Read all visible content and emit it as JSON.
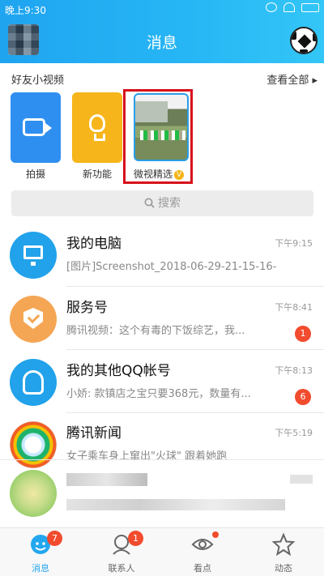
{
  "status": {
    "time": "晚上9:30"
  },
  "header": {
    "title": "消息"
  },
  "videos": {
    "section_title": "好友小视频",
    "see_all": "查看全部 ▸",
    "cards": [
      {
        "label": "拍摄"
      },
      {
        "label": "新功能"
      },
      {
        "label": "微视精选",
        "badge": "V"
      }
    ]
  },
  "search": {
    "placeholder": "搜索"
  },
  "conversations": [
    {
      "name": "我的电脑",
      "message": "[图片]Screenshot_2018-06-29-21-15-16-...",
      "time": "下午9:15",
      "unread": ""
    },
    {
      "name": "服务号",
      "message": "腾讯视频：这个有毒的下饭综艺，我...",
      "time": "下午8:41",
      "unread": "1"
    },
    {
      "name": "我的其他QQ帐号",
      "message": "小娇: 款镇店之宝只要368元，数量有...",
      "time": "下午8:13",
      "unread": "6"
    },
    {
      "name": "腾讯新闻",
      "message": "女子乘车身上窜出\"火球\" 跟着她跑",
      "time": "下午5:19",
      "unread": ""
    }
  ],
  "nav": {
    "tabs": [
      {
        "label": "消息",
        "badge": "7",
        "active": true
      },
      {
        "label": "联系人",
        "badge": "1"
      },
      {
        "label": "看点"
      },
      {
        "label": "动态"
      }
    ]
  },
  "colors": {
    "accent": "#1fa4f0",
    "highlight": "#d7111b",
    "badge": "#f24b2e"
  }
}
